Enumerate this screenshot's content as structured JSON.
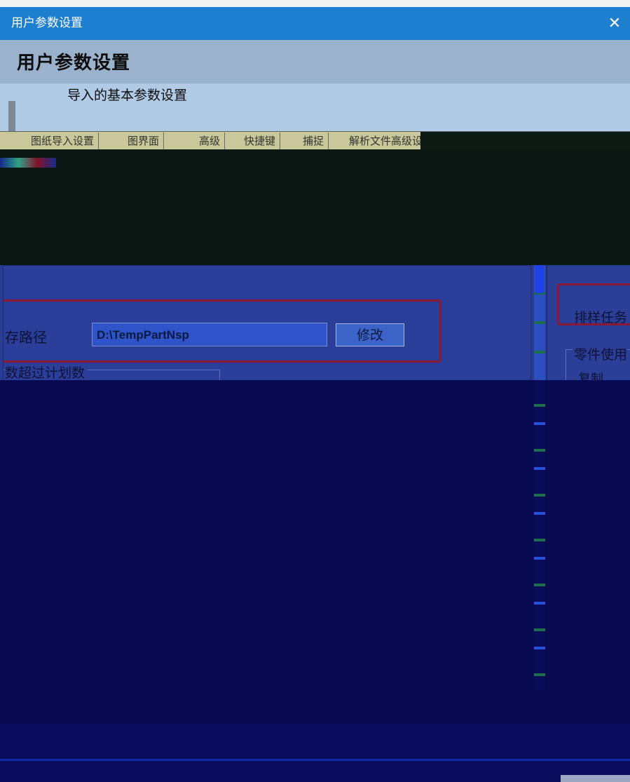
{
  "window": {
    "title": "用户参数设置",
    "close_symbol": "✕"
  },
  "header": {
    "title": "用户参数设置",
    "subtitle": "导入的基本参数设置"
  },
  "tabs": [
    {
      "label": "图纸导入设置"
    },
    {
      "label": "图界面"
    },
    {
      "label": "高级"
    },
    {
      "label": "快捷键"
    },
    {
      "label": "捕捉"
    },
    {
      "label": "解析文件高级设置"
    }
  ],
  "main": {
    "path_label": "存路径",
    "path_value": "D:\\TempPartNsp",
    "modify_button": "修改",
    "exceed_group_label": "数超过计划数"
  },
  "right": {
    "nest_task_label": "排样任务",
    "usage_group_label": "零件使用",
    "copy_label": "复制"
  },
  "colors": {
    "title_bar": "#1e7fd0",
    "highlight_border": "#8b1832"
  }
}
